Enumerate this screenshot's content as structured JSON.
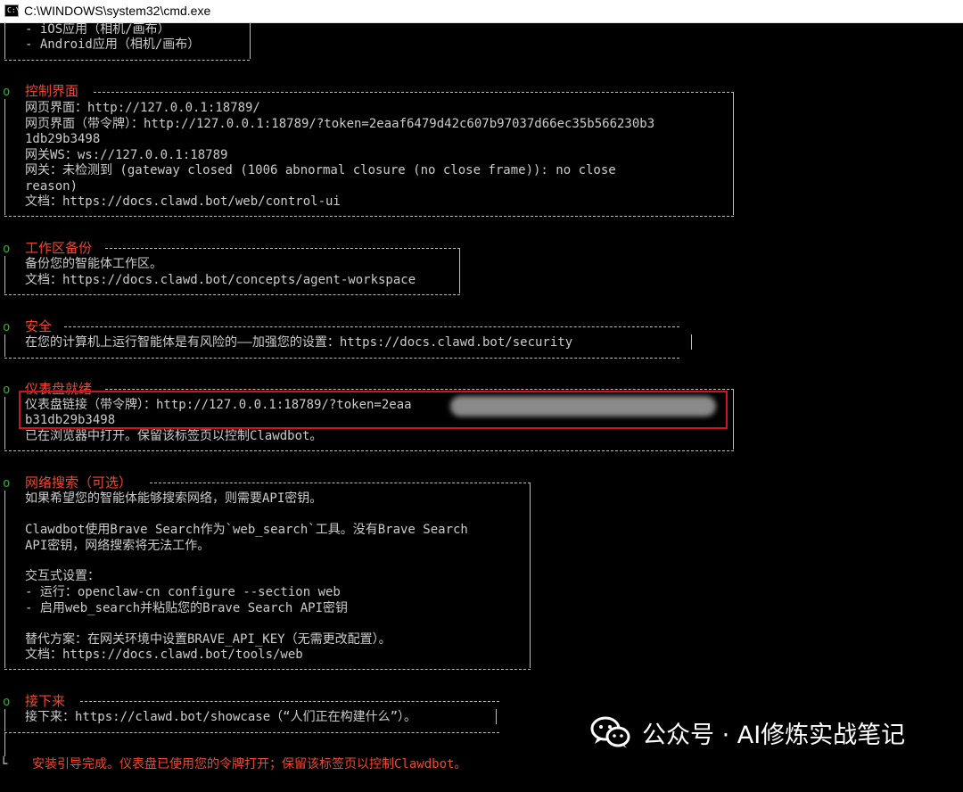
{
  "window": {
    "title": "C:\\WINDOWS\\system32\\cmd.exe",
    "icon": "cmd-icon"
  },
  "top": {
    "lines": [
      "- iOS应用（相机/画布）",
      "- Android应用（相机/画布）"
    ]
  },
  "control": {
    "header": "控制界面",
    "lines": [
      "网页界面：http://127.0.0.1:18789/",
      "网页界面（带令牌）：http://127.0.0.1:18789/?token=2eaaf6479d42c607b97037d66ec35b566230b3",
      "1db29b3498",
      "网关WS：ws://127.0.0.1:18789",
      "网关：未检测到 (gateway closed (1006 abnormal closure (no close frame)): no close",
      "reason)",
      "文档：https://docs.clawd.bot/web/control-ui"
    ]
  },
  "workspace": {
    "header": "工作区备份",
    "lines": [
      "备份您的智能体工作区。",
      "文档：https://docs.clawd.bot/concepts/agent-workspace"
    ]
  },
  "security": {
    "header": "安全",
    "lines": [
      "在您的计算机上运行智能体是有风险的——加强您的设置：https://docs.clawd.bot/security"
    ]
  },
  "dashboard": {
    "header": "仪表盘就绪",
    "lines": [
      "仪表盘链接（带令牌）：http://127.0.0.1:18789/?token=2eaa",
      "b31db29b3498",
      "已在浏览器中打开。保留该标签页以控制Clawdbot。"
    ]
  },
  "websearch": {
    "header": "网络搜索（可选）",
    "lines": [
      "如果希望您的智能体能够搜索网络，则需要API密钥。",
      "Clawdbot使用Brave Search作为`web_search`工具。没有Brave Search",
      "API密钥，网络搜索将无法工作。",
      "交互式设置：",
      "- 运行：openclaw-cn configure --section web",
      "- 启用web_search并粘贴您的Brave Search API密钥",
      "替代方案：在网关环境中设置BRAVE_API_KEY（无需更改配置）。",
      "文档：https://docs.clawd.bot/tools/web"
    ]
  },
  "next": {
    "header": "接下来",
    "lines": [
      "接下来：https://clawd.bot/showcase（“人们正在构建什么”）。"
    ]
  },
  "final": {
    "message": "安装引导完成。仪表盘已使用您的令牌打开；保留该标签页以控制Clawdbot。"
  },
  "glyphs": {
    "bullet": "o",
    "corner": "└"
  },
  "watermark": {
    "text": "公众号 · AI修炼实战笔记",
    "icon": "wechat-icon"
  },
  "colors": {
    "header": "#f0472f",
    "bullet": "#2faa2f",
    "text": "#cccccc",
    "highlight_box": "#d3131b"
  }
}
